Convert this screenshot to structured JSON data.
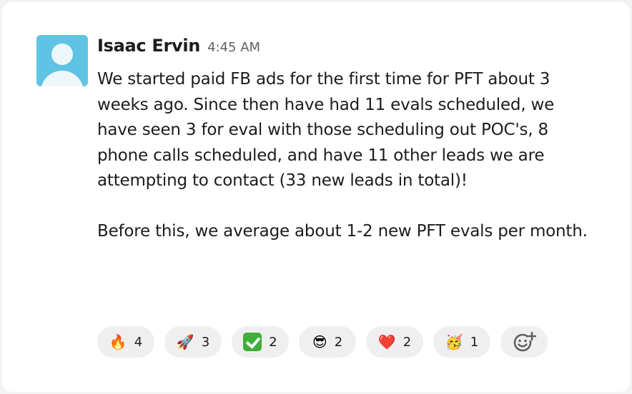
{
  "message": {
    "author": "Isaac Ervin",
    "timestamp": "4:45 AM",
    "paragraph_1": "We started paid FB ads for the first time for PFT about 3 weeks ago. Since then have had 11 evals scheduled, we have seen 3 for eval with those scheduling out POC's, 8 phone calls scheduled, and have 11 other leads we are attempting to contact (33 new leads in total)!",
    "paragraph_2": "Before this, we average about 1-2 new PFT evals per month."
  },
  "reactions": [
    {
      "emoji": "🔥",
      "icon": "fire-icon",
      "count": "4"
    },
    {
      "emoji": "🚀",
      "icon": "rocket-icon",
      "count": "3"
    },
    {
      "emoji": "✅",
      "icon": "white-check-mark-icon",
      "count": "2"
    },
    {
      "emoji": "😎",
      "icon": "sunglasses-face-icon",
      "count": "2"
    },
    {
      "emoji": "❤️",
      "icon": "red-heart-icon",
      "count": "2"
    },
    {
      "emoji": "🥳",
      "icon": "partying-face-icon",
      "count": "1"
    }
  ],
  "add_reaction": {
    "icon": "add-reaction-icon"
  },
  "colors": {
    "avatar_bg": "#5fc3e3",
    "text": "#1d1c1d",
    "muted": "#616061",
    "pill_bg": "#efefef"
  }
}
